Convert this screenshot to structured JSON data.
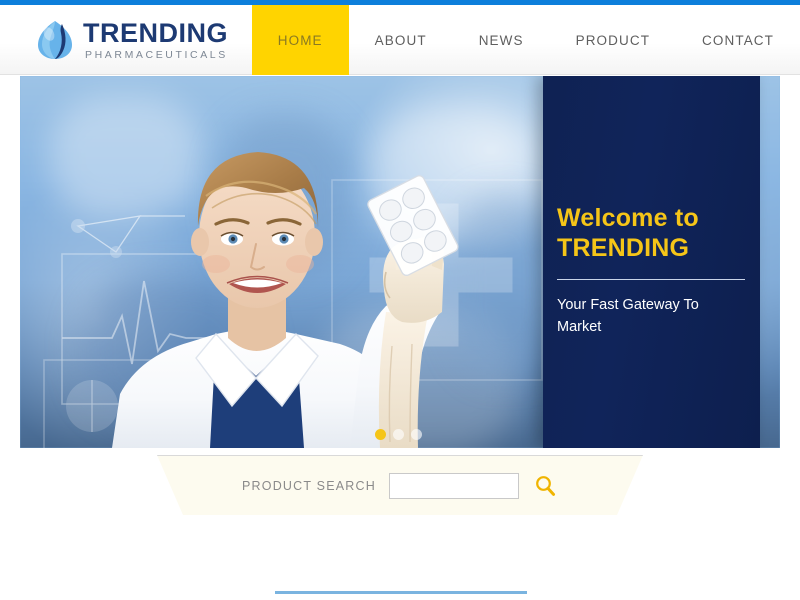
{
  "site": {
    "logo": {
      "name": "TRENDING",
      "tagline": "PHARMACEUTICALS",
      "mark_icon": "droplet-leaf-icon",
      "brand_blue": "#1d3a73",
      "mark_light_blue": "#4aa3e0"
    },
    "accent_top_bar_color": "#0d7fdb"
  },
  "nav": {
    "items": [
      {
        "label": "HOME",
        "active": true
      },
      {
        "label": "ABOUT",
        "active": false
      },
      {
        "label": "NEWS",
        "active": false
      },
      {
        "label": "PRODUCT",
        "active": false
      },
      {
        "label": "CONTACT",
        "active": false
      }
    ],
    "active_bg_color": "#ffd400",
    "active_text_color": "#8a7a22",
    "text_color": "#5e5e5e"
  },
  "hero": {
    "image_alt": "Smiling female pharmacist in white lab coat and latex glove holding a blister pack of pills, blurred blue medical background with white line-art overlays of an ECG waveform, molecule diagram and medical cross",
    "panel": {
      "heading_line1": "Welcome to",
      "heading_line2": "TRENDING",
      "subheading": "Your Fast Gateway To Market",
      "background_color": "#10245a",
      "heading_color": "#f5c518",
      "subheading_color": "#ffffff"
    },
    "slider": {
      "dots": 3,
      "active_index": 0,
      "active_color": "#f5c518",
      "inactive_color": "rgba(255,255,255,0.62)"
    }
  },
  "search": {
    "label": "PRODUCT SEARCH",
    "value": "",
    "placeholder": "",
    "button_icon": "search-magnifier-icon",
    "panel_background": "#fdfbef",
    "panel_border": "#e8cf4a",
    "icon_color": "#f0b400"
  },
  "footer": {
    "divider_color": "#7ab4e0"
  }
}
